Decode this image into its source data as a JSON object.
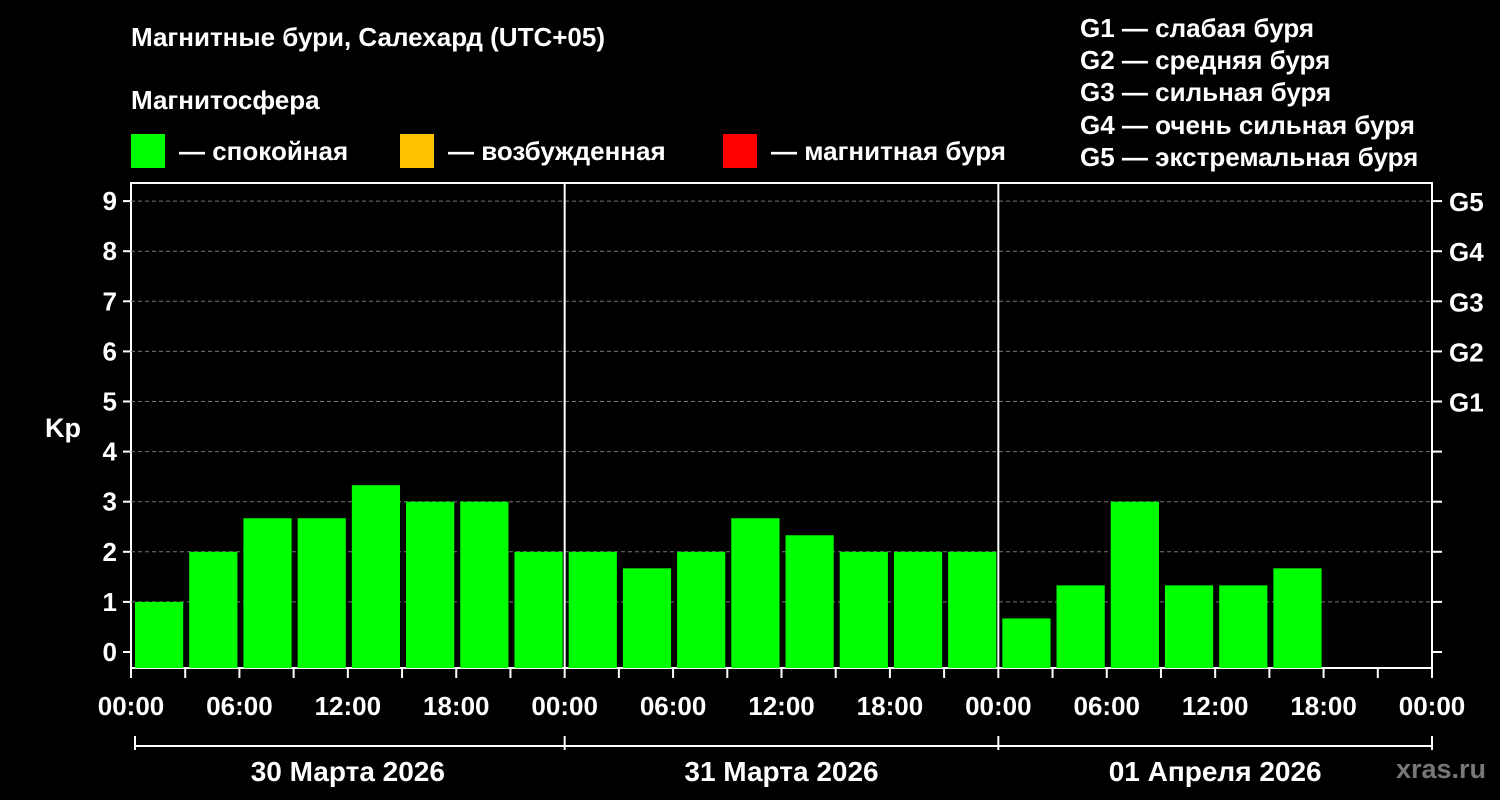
{
  "title": "Магнитные бури, Салехард (UTC+05)",
  "subtitle": "Магнитосфера",
  "legend": [
    {
      "label": "— спокойная",
      "color": "#00ff00"
    },
    {
      "label": "— возбужденная",
      "color": "#ffc000"
    },
    {
      "label": "— магнитная буря",
      "color": "#ff0000"
    }
  ],
  "g_scale": [
    "G1 — слабая буря",
    "G2 — средняя буря",
    "G3 — сильная буря",
    "G4 — очень сильная буря",
    "G5 — экстремальная буря"
  ],
  "watermark": "xras.ru",
  "chart_data": {
    "type": "bar",
    "ylabel": "Kp",
    "ylim": [
      0,
      9
    ],
    "y_ticks": [
      "0",
      "1",
      "2",
      "3",
      "4",
      "5",
      "6",
      "7",
      "8",
      "9"
    ],
    "right_ticks": [
      {
        "value": 5,
        "label": "G1"
      },
      {
        "value": 6,
        "label": "G2"
      },
      {
        "value": 7,
        "label": "G3"
      },
      {
        "value": 8,
        "label": "G4"
      },
      {
        "value": 9,
        "label": "G5"
      }
    ],
    "x_ticks": [
      "00:00",
      "06:00",
      "12:00",
      "18:00",
      "00:00",
      "06:00",
      "12:00",
      "18:00",
      "00:00",
      "06:00",
      "12:00",
      "18:00",
      "00:00"
    ],
    "days": [
      "30 Марта 2026",
      "31 Марта 2026",
      "01 Апреля 2026"
    ],
    "grid": true,
    "series": [
      {
        "color": "#00ff00",
        "values": [
          1.0,
          2.0,
          2.67,
          2.67,
          3.33,
          3.0,
          3.0,
          2.0,
          2.0,
          1.67,
          2.0,
          2.67,
          2.33,
          2.0,
          2.0,
          2.0,
          0.67,
          1.33,
          3.0,
          1.33,
          1.33,
          1.67
        ]
      }
    ]
  }
}
